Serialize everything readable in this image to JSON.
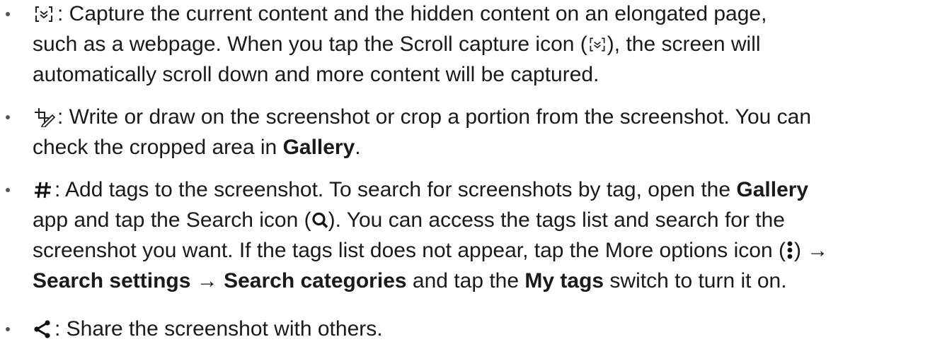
{
  "items": [
    {
      "icon": "scroll-capture-icon",
      "lines": [
        {
          "t1": ": Capture the current content and the hidden content on an elongated page,"
        },
        {
          "t1": "such as a webpage. When you tap the Scroll capture icon (",
          "t2": "), the screen will"
        },
        {
          "t1": "automatically scroll down and more content will be captured."
        }
      ]
    },
    {
      "icon": "draw-crop-icon",
      "lines": [
        {
          "t1": ": Write or draw on the screenshot or crop a portion from the screenshot. You can"
        },
        {
          "t1": "check the cropped area in ",
          "b1": "Gallery",
          "t2": "."
        }
      ]
    },
    {
      "icon": "hashtag-icon",
      "lines": [
        {
          "t1": ": Add tags to the screenshot. To search for screenshots by tag, open the ",
          "b1": "Gallery"
        },
        {
          "t1": "app and tap the Search icon (",
          "t2": "). You can access the tags list and search for the"
        },
        {
          "t1": "screenshot you want. If the tags list does not appear, tap the More options icon (",
          "t2": ") →"
        },
        {
          "b1": "Search settings",
          "t1": " → ",
          "b2": "Search categories",
          "t2": " and tap the ",
          "b3": "My tags",
          "t3": " switch to turn it on."
        }
      ]
    },
    {
      "icon": "share-icon",
      "lines": [
        {
          "t1": ": Share the screenshot with others."
        }
      ]
    }
  ]
}
